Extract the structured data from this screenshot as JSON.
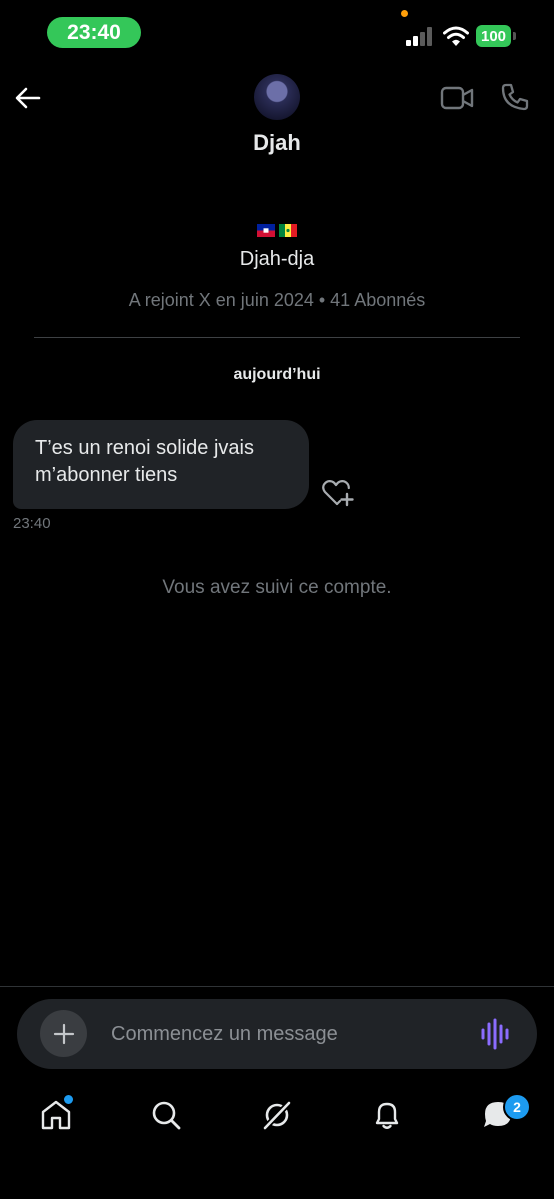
{
  "status_bar": {
    "time": "23:40",
    "battery": "100"
  },
  "header": {
    "name": "Djah"
  },
  "profile": {
    "flags": [
      "haiti-flag",
      "senegal-flag"
    ],
    "handle": "Djah-dja",
    "meta": "A rejoint X en juin 2024 • 41 Abonnés"
  },
  "conversation": {
    "date_separator": "aujourd’hui",
    "messages": [
      {
        "text": "T’es un renoi solide jvais m’abonner tiens",
        "time": "23:40"
      }
    ],
    "system_note": "Vous avez suivi ce compte."
  },
  "composer": {
    "placeholder": "Commencez un message"
  },
  "nav": {
    "items": [
      "home-icon",
      "search-icon",
      "grok-icon",
      "bell-icon",
      "messages-icon"
    ],
    "messages_badge": "2"
  },
  "colors": {
    "accent": "#1d9bf0",
    "status_green": "#34c759",
    "bubble": "#202327",
    "muted": "#71767b"
  }
}
